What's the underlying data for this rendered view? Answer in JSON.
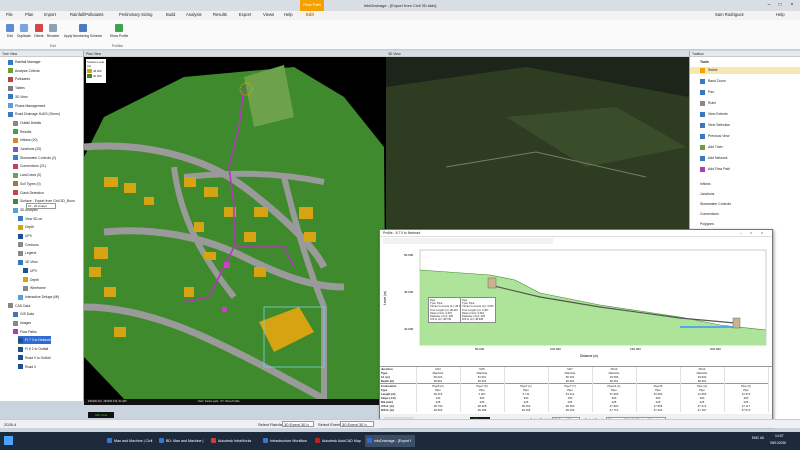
{
  "app": {
    "title": "InfoDrainage - [Export from Civil 3D.iddx]",
    "context_tab": "Flow Path",
    "user": "Sam Rodriguez",
    "help": "Help"
  },
  "menu": [
    "File",
    "Plan",
    "Import",
    "Rainfall/Pollutants",
    "Preliminary Sizing",
    "Build",
    "Analysis",
    "Results",
    "Export",
    "Views",
    "Help",
    "Edit"
  ],
  "ribbon": {
    "buttons": [
      "Edit",
      "Duplicate",
      "Delete",
      "Rename",
      "Apply Numbering Scheme",
      "Show Profile"
    ],
    "groups": [
      "Edit",
      "Profiles"
    ]
  },
  "panes": {
    "tree": "Tree View",
    "plan": "Plan View",
    "view3d": "3D View",
    "toolbox": "Toolbox"
  },
  "tree": [
    "Rainfall Manager",
    "Analysis Criteria",
    "Pollutants",
    "Tables",
    "3D View",
    "Phase Management",
    "Road Drainage SuDS (Storm)",
    "Outfall Details",
    "Results",
    "Inflows (20)",
    "Junctions (20)",
    "Stormwater Controls (2)",
    "Connections (21)",
    "Land Uses (0)",
    "Soil Types (0)",
    "Clash Detection",
    "Surface - Export from Civil 3D_Boun",
    "3D Analysis",
    "View 3D on",
    "Depth",
    "UPV",
    "Contours",
    "Legend",
    "3D View",
    "UPV",
    "Depth",
    "Wireframe",
    "Interactive Deluge (MI)",
    "CAD Data",
    "GIS Data",
    "Images",
    "Flow Paths",
    "FI 7 0 to Network",
    "FI 6 2 to Outfall",
    "Road 0 to Outfall",
    "Road 4"
  ],
  "tree_view3d_select": "10 - 20 Analys",
  "legend": {
    "title": "Surface Level (m)",
    "high": "48.000",
    "low": "40.000"
  },
  "plan_status": {
    "coords": "E56490.261, 482259.349, 52.480",
    "hint": "<Del> Delete path, <P> Show Profile"
  },
  "toolbox": {
    "tools_header": "Tools",
    "tools": [
      "Select",
      "Band Zoom",
      "Pan",
      "Ruler",
      "View Extents",
      "View Selection",
      "Previous View",
      "Add Train",
      "Add Network",
      "Add Flow Path"
    ],
    "sections": [
      "Inflows",
      "Junctions",
      "Stormwater Controls",
      "Connections",
      "Polygons"
    ]
  },
  "profile": {
    "title": "Profile - 8.7 0 to Network",
    "ylabel": "Level (m)",
    "xlabel": "Distance (m)",
    "yticks": [
      "50.000",
      "45.000",
      "40.000"
    ],
    "xticks": [
      "50.000",
      "100.000",
      "150.000",
      "200.000"
    ],
    "callout1": [
      "Pipe",
      "Type: Pipe",
      "Centre to Centre (m): 28.616",
      "True Length (m): 28.416",
      "Slope (m/m): 0.007",
      "Diameter (mm): 225",
      "U/S IL (m): 48.730"
    ],
    "callout2": [
      "Pipe",
      "Type: Pipe",
      "Centre to Centre (m): 4.607",
      "True Length (m): 4.407",
      "Slope (m/m): 0.015",
      "Diameter (mm): 225",
      "D/S IL (m): 48.328"
    ],
    "row_labels": [
      "Junction",
      "Type",
      "CL (m)",
      "Depth (m)",
      "Connection",
      "Type",
      "Length (m)",
      "Slope (1:X)",
      "Dia (mm)",
      "U/S IL (m)",
      "D/S IL (m)"
    ],
    "columns": [
      {
        "j": "MJ3",
        "jt": "Manhole",
        "cl": "50.024",
        "d": "48.661",
        "c": "Pipe5 (2)",
        "ct": "Pipe",
        "len": "28.416",
        "sl": "130",
        "dia": "225",
        "us": "48.730",
        "ds": "48.503"
      },
      {
        "j": "MJ5",
        "jt": "Manhole",
        "cl": "51.061",
        "d": "48.461",
        "c": "Pipe7 (5)",
        "ct": "Pipe",
        "len": "4.407",
        "sl": "300",
        "dia": "225",
        "us": "48.328",
        "ds": "48.189"
      },
      {
        "j": "",
        "jt": "",
        "cl": "",
        "d": "",
        "c": "Pipe7 (1)",
        "ct": "Pipe",
        "len": "5.711",
        "sl": "300",
        "dia": "225",
        "us": "48.163",
        "ds": "48.156"
      },
      {
        "j": "MJ7",
        "jt": "Manhole",
        "cl": "50.153",
        "d": "48.461",
        "c": "Pipe7 (7)",
        "ct": "Pipe",
        "len": "44.412",
        "sl": "150",
        "dia": "225",
        "us": "48.150",
        "ds": "48.100"
      },
      {
        "j": "MJ13",
        "jt": "Manhole",
        "cl": "49.596",
        "d": "48.461",
        "c": "Pipe14 (1)",
        "ct": "Pipe",
        "len": "57.469",
        "sl": "300",
        "dia": "225",
        "us": "47.900",
        "ds": "47.712"
      },
      {
        "j": "",
        "jt": "",
        "cl": "",
        "d": "",
        "c": "Pipe15",
        "ct": "Pipe",
        "len": "49.250",
        "sl": "300",
        "dia": "225",
        "us": "47.566",
        "ds": "47.423"
      },
      {
        "j": "MJ14",
        "jt": "Manhole",
        "cl": "49.930",
        "d": "48.461",
        "c": "Pipe (2)",
        "ct": "Pipe",
        "len": "21.656",
        "sl": "300",
        "dia": "225",
        "us": "47.272",
        "ds": "47.197"
      },
      {
        "j": "",
        "jt": "",
        "cl": "",
        "d": "",
        "c": "Pipe (2)",
        "ct": "Pipe",
        "len": "12.574",
        "sl": "300",
        "dia": "225",
        "us": "47.117",
        "ds": "47.073"
      }
    ],
    "bottom": {
      "rainfall_label": "Select Rainfall",
      "rainfall": "30 Event 30 h",
      "event_label": "Select Event",
      "event": "30 years: +10 % 1440 mins 'Winter'",
      "time": "400 mins"
    }
  },
  "statusbar": {
    "left": "2026.4",
    "rainfall_label": "Select Rainfall",
    "rainfall": "30 Event 30 h",
    "event_label": "Select Event",
    "event": "30 Event 30 h",
    "time": "400 mins"
  },
  "taskbar": {
    "items": [
      "Man and Machine | Civil",
      "BD: Man and Machine |",
      "Autodesk InfraWorks",
      "Infrastructure Workflow",
      "Autodesk AutoCAD Map",
      "InfoDrainage - [Export f"
    ],
    "clock": "14:57",
    "date": "09/01/2026",
    "lang": "ENG UK"
  },
  "colors": {
    "accent": "#f6a000",
    "plan_grass": "#3f8a2c",
    "road": "#9a9a9a",
    "building": "#d6a413",
    "network": "#b03ab8"
  }
}
